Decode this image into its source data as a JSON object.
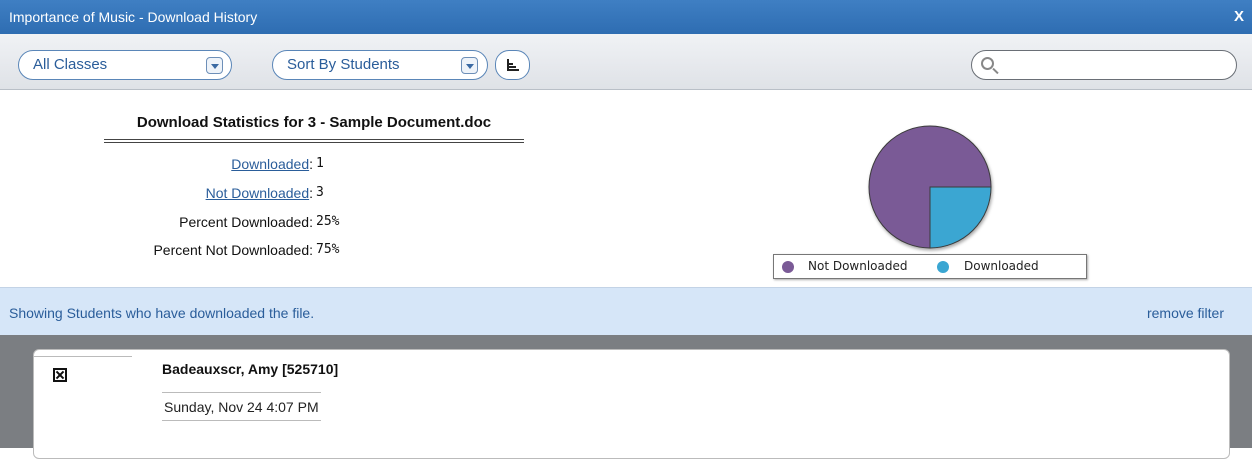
{
  "window": {
    "title": "Importance of Music - Download History",
    "close_label": "X"
  },
  "toolbar": {
    "class_filter": "All Classes",
    "sort_by": "Sort By Students",
    "sort_icon": "sort-bars-icon",
    "search": {
      "value": "",
      "placeholder": ""
    }
  },
  "stats": {
    "title": "Download Statistics for 3 - Sample Document.doc",
    "rows": [
      {
        "label": "Downloaded",
        "value": "1",
        "link": true
      },
      {
        "label": "Not Downloaded",
        "value": "3",
        "link": true
      },
      {
        "label": "Percent Downloaded",
        "value": "25%",
        "link": false
      },
      {
        "label": "Percent Not Downloaded",
        "value": "75%",
        "link": false
      }
    ]
  },
  "chart_data": {
    "type": "pie",
    "title": "",
    "series": [
      {
        "name": "Not Downloaded",
        "value": 3,
        "color": "#7a5a96"
      },
      {
        "name": "Downloaded",
        "value": 1,
        "color": "#3aa6d2"
      }
    ],
    "legend_position": "bottom"
  },
  "filter": {
    "message": "Showing Students who have downloaded the file.",
    "remove_label": "remove filter"
  },
  "students": [
    {
      "name": "Badeauxscr, Amy  [525710]",
      "date": "Sunday,  Nov 24    4:07 PM"
    }
  ]
}
